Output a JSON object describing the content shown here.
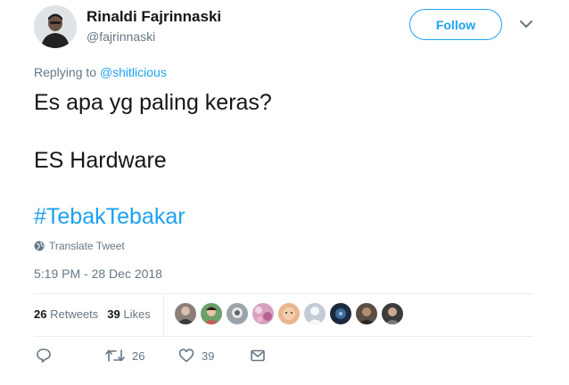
{
  "user": {
    "name": "Rinaldi Fajrinnaski",
    "handle": "@fajrinnaski"
  },
  "follow_button": {
    "label": "Follow"
  },
  "reply_context": {
    "prefix": "Replying to ",
    "target": "@shitlicious"
  },
  "tweet": {
    "line1": "Es apa yg paling keras?",
    "line2": "ES Hardware",
    "hashtag": "#TebakTebakar"
  },
  "translate_label": "Translate Tweet",
  "timestamp": "5:19 PM - 28 Dec 2018",
  "stats": {
    "retweets_count": "26",
    "retweets_label": "Retweets",
    "likes_count": "39",
    "likes_label": "Likes"
  },
  "likers": [
    {
      "icon": "liker-avatar-1",
      "color": "#8a7f78"
    },
    {
      "icon": "liker-avatar-2",
      "color": "#6aa06a"
    },
    {
      "icon": "liker-avatar-3",
      "color": "#9aa3ab"
    },
    {
      "icon": "liker-avatar-4",
      "color": "#d7a1c0"
    },
    {
      "icon": "liker-avatar-5",
      "color": "#e8b58c"
    },
    {
      "icon": "liker-avatar-6",
      "color": "#c3ccd4"
    },
    {
      "icon": "liker-avatar-7",
      "color": "#1b2a3c"
    },
    {
      "icon": "liker-avatar-8",
      "color": "#5a4e44"
    },
    {
      "icon": "liker-avatar-9",
      "color": "#3b3b3b"
    }
  ],
  "actions": {
    "reply_icon": "reply-icon",
    "retweet_icon": "retweet-icon",
    "retweet_count": "26",
    "like_icon": "heart-icon",
    "like_count": "39",
    "dm_icon": "envelope-icon"
  },
  "colors": {
    "accent": "#1da1f2",
    "text": "#14171a",
    "muted": "#657786",
    "divider": "#e6ecf0"
  }
}
